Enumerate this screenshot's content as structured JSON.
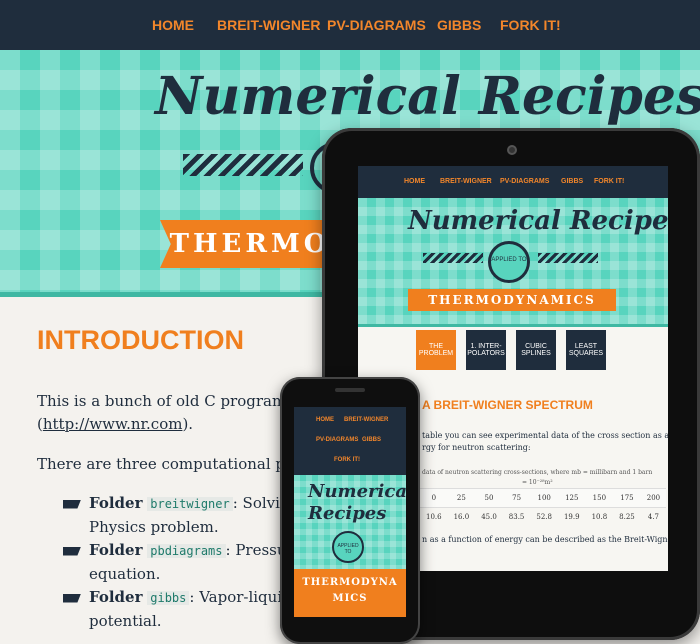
{
  "nav": {
    "items": [
      "Home",
      "Breit-Wigner",
      "PV-Diagrams",
      "Gibbs",
      "Fork it!"
    ]
  },
  "hero": {
    "title": "Numerical Recipes",
    "subtitle": "Applied to",
    "banner": "THERMO",
    "banner_full": "THERMODYNAMICS",
    "banner_phone_1": "THERMODYNA",
    "banner_phone_2": "MICS"
  },
  "intro": {
    "heading": "INTRODUCTION",
    "p1_start": "This is a bunch of old C programs b",
    "p1_link": "http://www.nr.com",
    "p1_end": ").",
    "p2": "There are three computational phys",
    "folders": [
      {
        "label": "Folder",
        "code": "breitwigner",
        "text": ": Solvi",
        "cont": "Physics problem."
      },
      {
        "label": "Folder",
        "code": "pbdiagrams",
        "text": ": Pressu",
        "cont": "equation."
      },
      {
        "label": "Folder",
        "code": "gibbs",
        "text": ": Vapor-liqui",
        "cont": "potential."
      }
    ]
  },
  "tablet": {
    "tabs": [
      "The Problem",
      "1. Inter-polators",
      "Cubic Splines",
      "Least Squares"
    ],
    "section_heading": "A BREIT-WIGNER SPECTRUM",
    "p1a": "table you can see experimental data of the cross section as a",
    "p1b": "rgy for neutron scattering:",
    "caption": "data of neutron scattering cross-sections, where mb = millibarn and 1 barn",
    "caption2": "= 10⁻²⁸m²",
    "row1": [
      "0",
      "25",
      "50",
      "75",
      "100",
      "125",
      "150",
      "175",
      "200"
    ],
    "row2": [
      "10.6",
      "16.0",
      "45.0",
      "83.5",
      "52.8",
      "19.9",
      "10.8",
      "8.25",
      "4.7"
    ],
    "p2": "n as a function of energy can be described as the Breit-Wigner"
  }
}
